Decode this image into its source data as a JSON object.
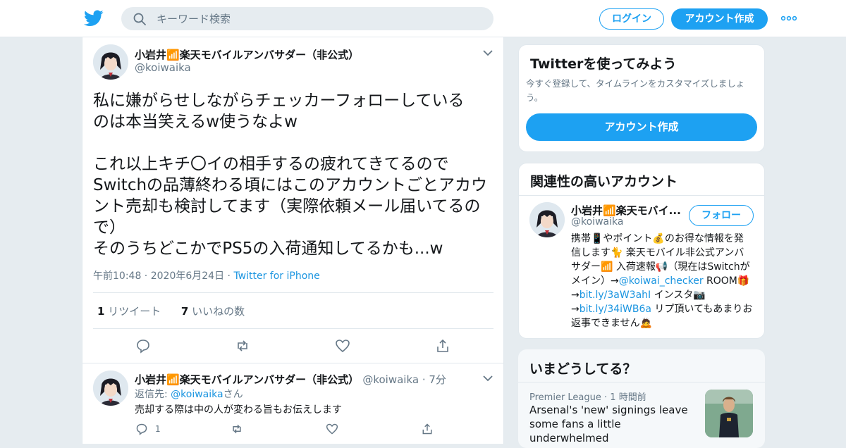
{
  "header": {
    "search_placeholder": "キーワード検索",
    "login_label": "ログイン",
    "signup_label": "アカウント作成"
  },
  "tweet": {
    "display_name": "小岩井📶楽天モバイルアンバサダー（非公式）",
    "handle": "@koiwaika",
    "text": "私に嫌がらせしながらチェッカーフォローしている\nのは本当笑えるw使うなよw\n\nこれ以上キチ〇イの相手するの疲れてきてるので\nSwitchの品薄終わる頃にはこのアカウントごとアカウ\nント売却も検討してます（実際依頼メール届いてるの\nで）\nそのうちどこかでPS5の入荷通知してるかも...w",
    "time": "午前10:48",
    "date": "2020年6月24日",
    "source": "Twitter for iPhone",
    "retweet_count": "1",
    "retweet_label": "リツイート",
    "like_count": "7",
    "like_label": "いいねの数"
  },
  "reply": {
    "display_name": "小岩井📶楽天モバイルアンバサダー（非公式）",
    "handle": "@koiwaika",
    "age": "7分",
    "reply_to_prefix": "返信先: ",
    "reply_to_handle": "@koiwaika",
    "reply_to_suffix": "さん",
    "text": "売却する際は中の人が変わる旨もお伝えします",
    "reply_count": "1"
  },
  "sidebar": {
    "try_title": "Twitterを使ってみよう",
    "try_desc": "今すぐ登録して、タイムラインをカスタマイズしましょう。",
    "try_button": "アカウント作成",
    "related_title": "関連性の高いアカウント",
    "related": {
      "name": "小岩井📶楽天モバイ...",
      "handle": "@koiwaika",
      "follow_label": "フォロー",
      "bio_1": "携帯📱やポイント💰のお得な情報を発信します🐈 楽天モバイル非公式アンバサダー📶 入荷速報📢（現在はSwitchがメイン）→",
      "bio_link_1": "@koiwai_checker",
      "bio_2": " ROOM🎁→",
      "bio_link_2": "bit.ly/3aW3ahI",
      "bio_3": " インスタ📷→",
      "bio_link_3": "bit.ly/34iWB6a",
      "bio_4": " リプ頂いてもあまりお返事できません🙇"
    },
    "trends_title": "いまどうしてる？",
    "trend": {
      "category": "Premier League",
      "age": "1 時間前",
      "headline": "Arsenal's 'new' signings leave some fans a little underwhelmed"
    }
  },
  "colors": {
    "accent": "#1da1f2",
    "link": "#1b95e0",
    "muted": "#657786",
    "background": "#e6ecf0"
  }
}
